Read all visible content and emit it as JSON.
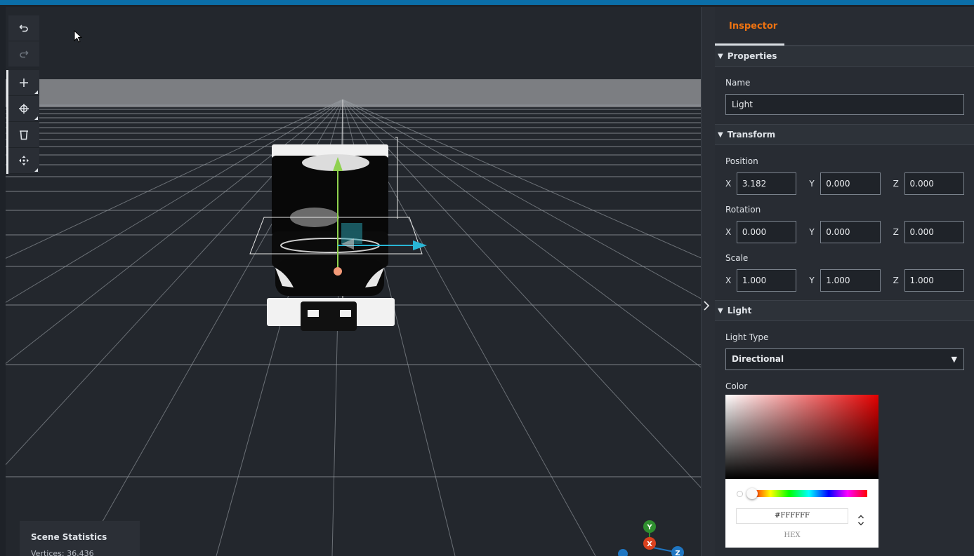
{
  "toolbar": {
    "undo": "undo-icon",
    "redo": "redo-icon",
    "add": "plus-icon",
    "add_component": "component-icon",
    "delete": "trash-icon",
    "transform": "move-icon"
  },
  "scene_statistics": {
    "title": "Scene Statistics",
    "vertices": "Vertices: 36,436"
  },
  "gizmo": {
    "y": "Y",
    "x": "X",
    "z": "Z"
  },
  "inspector": {
    "tab": "Inspector",
    "sections": {
      "properties": "Properties",
      "transform": "Transform",
      "light": "Light"
    },
    "properties": {
      "name_label": "Name",
      "name_value": "Light"
    },
    "transform": {
      "position_label": "Position",
      "rotation_label": "Rotation",
      "scale_label": "Scale",
      "axis_x": "X",
      "axis_y": "Y",
      "axis_z": "Z",
      "position": {
        "x": "3.182",
        "y": "0.000",
        "z": "0.000"
      },
      "rotation": {
        "x": "0.000",
        "y": "0.000",
        "z": "0.000"
      },
      "scale": {
        "x": "1.000",
        "y": "1.000",
        "z": "1.000"
      }
    },
    "light": {
      "type_label": "Light Type",
      "type_value": "Directional",
      "color_label": "Color",
      "hex_value": "#FFFFFF",
      "hex_label": "HEX"
    }
  },
  "colors": {
    "accent": "#ec7211",
    "top_bar": "#0b6ea8",
    "viewport_bg": "#23272d",
    "panel_bg": "#282c33",
    "gizmo_y": "#2f8f2f",
    "gizmo_x": "#d9411e",
    "gizmo_z": "#1f76c2"
  }
}
